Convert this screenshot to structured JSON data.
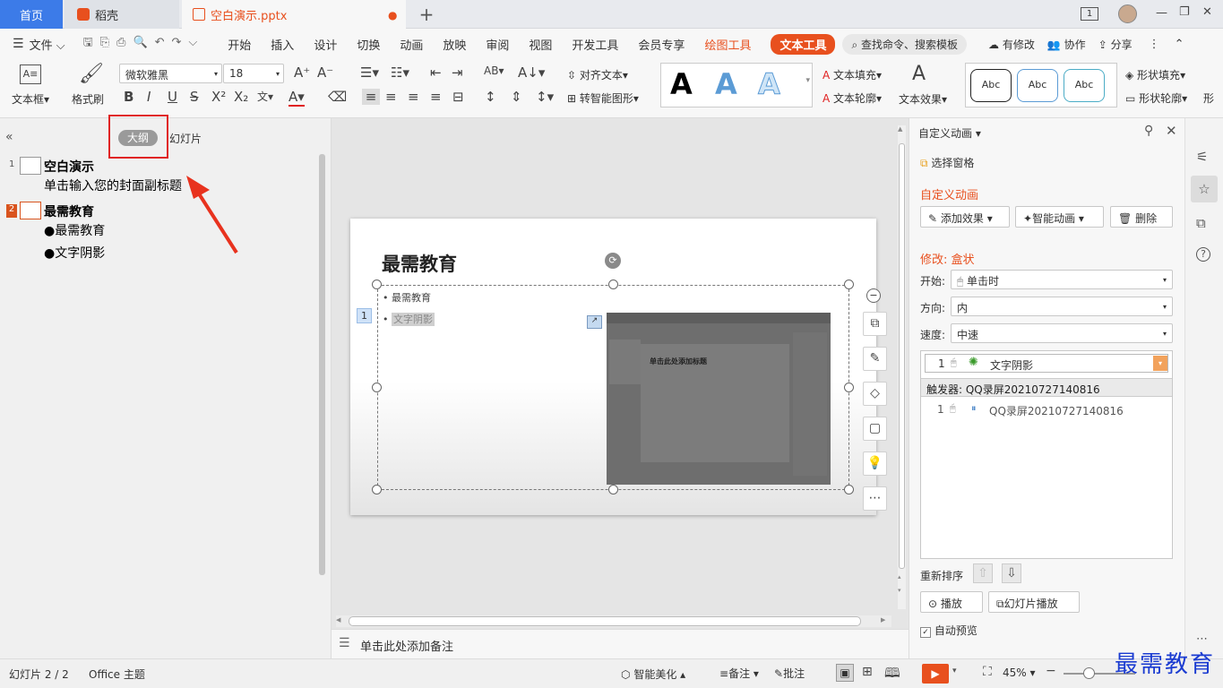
{
  "tabs": {
    "home": "首页",
    "daoke": "稻壳",
    "file": "空白演示.pptx",
    "new": "+"
  },
  "window": {
    "badge": "1",
    "minimize": "—",
    "restore": "❐",
    "close": "✕"
  },
  "menu": {
    "file": "文件",
    "items": [
      "开始",
      "插入",
      "设计",
      "切换",
      "动画",
      "放映",
      "审阅",
      "视图",
      "开发工具",
      "会员专享"
    ],
    "drawing_tools": "绘图工具",
    "text_tools": "文本工具",
    "search": "查找命令、搜索模板",
    "edit": "有修改",
    "collab": "协作",
    "share": "分享"
  },
  "ribbon": {
    "textbox": "文本框",
    "format_painter": "格式刷",
    "font": "微软雅黑",
    "size": "18",
    "align_text": "对齐文本",
    "smart_shape": "转智能图形",
    "text_fill": "文本填充",
    "text_outline": "文本轮廓",
    "text_effect": "文本效果",
    "shape_fill": "形状填充",
    "shape_outline": "形状轮廓",
    "style_sample": "Abc",
    "wordart": "A",
    "more": "形"
  },
  "left": {
    "tab_outline": "大纲",
    "tab_slides": "幻灯片",
    "items": [
      {
        "num": "1",
        "title": "空白演示",
        "sub": [
          "单击输入您的封面副标题"
        ]
      },
      {
        "num": "2",
        "title": "最需教育",
        "sub": [
          "●最需教育",
          "●文字阴影"
        ]
      }
    ]
  },
  "slide": {
    "title": "最需教育",
    "bullets": [
      "最需教育",
      "文字阴影"
    ],
    "anim_num": "1",
    "thumb_title": "单击此处添加标题",
    "notes": "单击此处添加备注"
  },
  "right": {
    "header": "自定义动画",
    "select_pane": "选择窗格",
    "section": "自定义动画",
    "add_effect": "添加效果",
    "smart_anim": "智能动画",
    "delete": "删除",
    "modify": "修改: 盒状",
    "start_label": "开始:",
    "start_value": "单击时",
    "direction_label": "方向:",
    "direction_value": "内",
    "speed_label": "速度:",
    "speed_value": "中速",
    "list_item": {
      "num": "1",
      "name": "文字阴影"
    },
    "trigger": "触发器: QQ录屏20210727140816",
    "trigger_item": {
      "num": "1",
      "name": "QQ录屏20210727140816"
    },
    "reorder": "重新排序",
    "play": "播放",
    "slideshow": "幻灯片播放",
    "autopreview": "自动预览"
  },
  "status": {
    "slide": "幻灯片 2 / 2",
    "theme": "Office 主题",
    "beautify": "智能美化",
    "notes": "备注",
    "comments": "批注",
    "zoom": "45%"
  },
  "watermark": "最需教育"
}
